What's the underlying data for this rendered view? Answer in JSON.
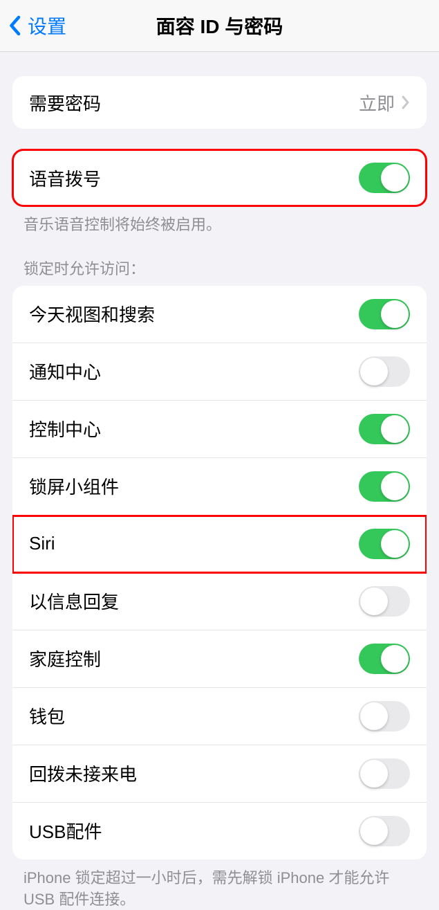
{
  "nav": {
    "back_label": "设置",
    "title": "面容 ID 与密码"
  },
  "require_passcode": {
    "label": "需要密码",
    "value": "立即"
  },
  "voice_dial": {
    "label": "语音拨号",
    "footer": "音乐语音控制将始终被启用。"
  },
  "lock_access": {
    "header": "锁定时允许访问：",
    "items": [
      {
        "label": "今天视图和搜索",
        "on": true
      },
      {
        "label": "通知中心",
        "on": false
      },
      {
        "label": "控制中心",
        "on": true
      },
      {
        "label": "锁屏小组件",
        "on": true
      },
      {
        "label": "Siri",
        "on": true
      },
      {
        "label": "以信息回复",
        "on": false
      },
      {
        "label": "家庭控制",
        "on": true
      },
      {
        "label": "钱包",
        "on": false
      },
      {
        "label": "回拨未接来电",
        "on": false
      },
      {
        "label": "USB配件",
        "on": false
      }
    ],
    "footer": "iPhone 锁定超过一小时后，需先解锁 iPhone 才能允许USB 配件连接。"
  }
}
